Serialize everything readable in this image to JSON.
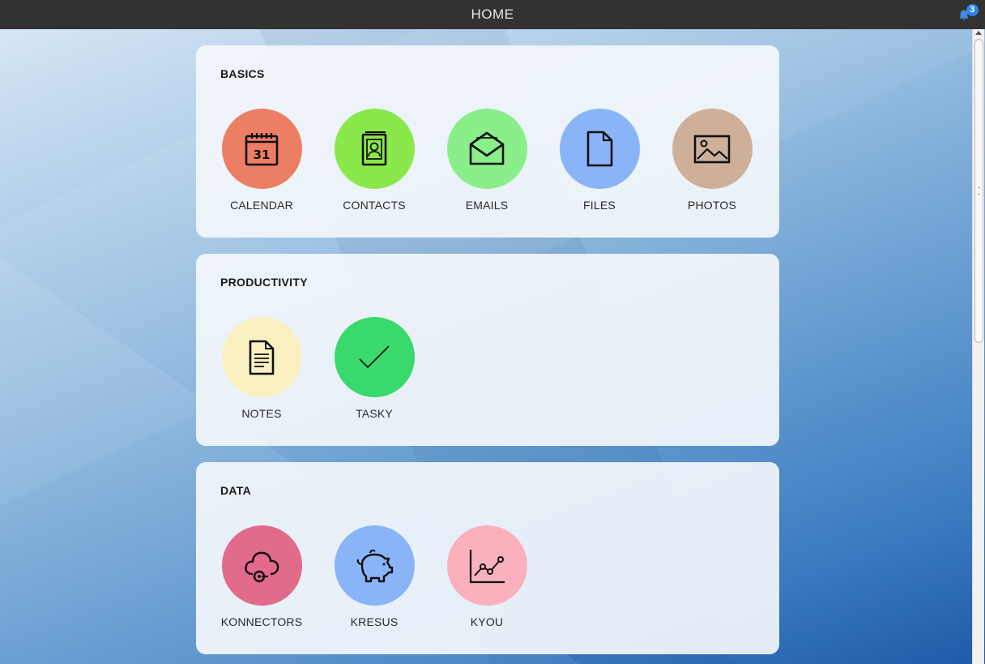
{
  "topbar": {
    "title": "HOME",
    "notification_count": "3"
  },
  "sections": [
    {
      "title": "BASICS",
      "apps": [
        {
          "label": "CALENDAR",
          "color": "#ec7e64",
          "icon": "calendar-icon",
          "day": "31"
        },
        {
          "label": "CONTACTS",
          "color": "#8be84a",
          "icon": "contacts-book-icon"
        },
        {
          "label": "EMAILS",
          "color": "#8aee8a",
          "icon": "envelope-icon"
        },
        {
          "label": "FILES",
          "color": "#8ab4f8",
          "icon": "file-icon"
        },
        {
          "label": "PHOTOS",
          "color": "#ceb09a",
          "icon": "image-icon"
        }
      ]
    },
    {
      "title": "PRODUCTIVITY",
      "apps": [
        {
          "label": "NOTES",
          "color": "#fbf0c2",
          "icon": "note-icon"
        },
        {
          "label": "TASKY",
          "color": "#39d96b",
          "icon": "checkmark-icon"
        }
      ]
    },
    {
      "title": "DATA",
      "apps": [
        {
          "label": "KONNECTORS",
          "color": "#e26a8a",
          "icon": "cloud-connector-icon"
        },
        {
          "label": "KRESUS",
          "color": "#8ab4f8",
          "icon": "piggy-bank-icon"
        },
        {
          "label": "KYOU",
          "color": "#fbb0bd",
          "icon": "line-chart-icon"
        }
      ]
    }
  ]
}
